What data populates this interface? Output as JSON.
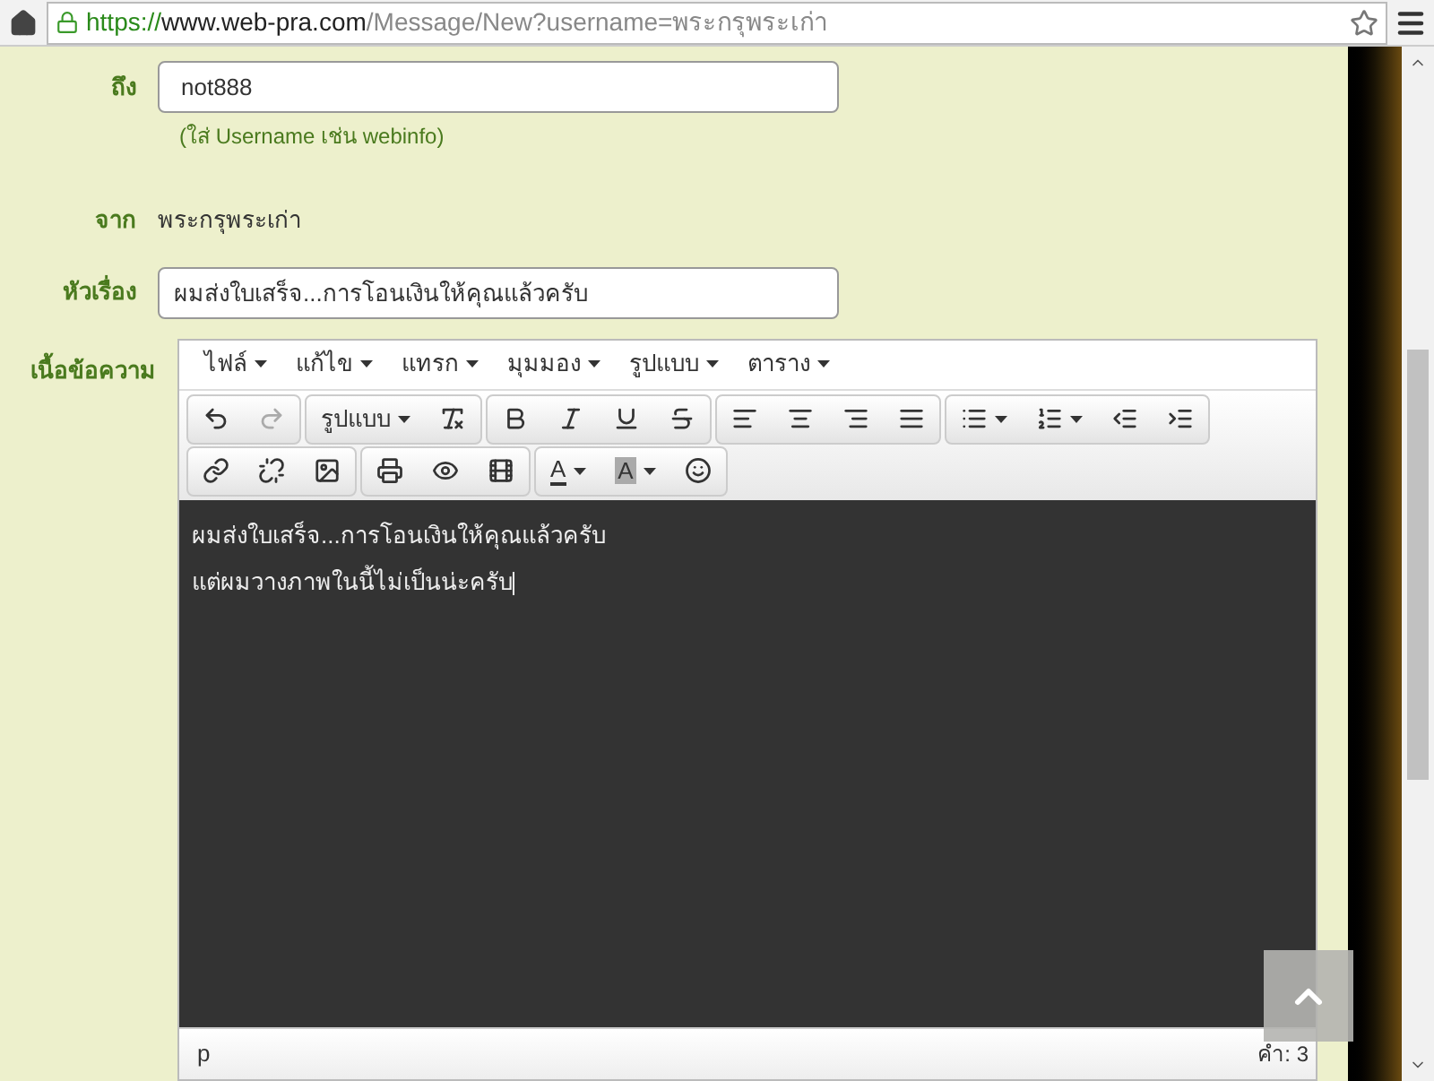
{
  "address_bar": {
    "scheme": "https://",
    "host": "www.web-pra.com",
    "path": "/Message/New?username=พระกรุพระเก่า"
  },
  "form": {
    "to": {
      "label": "ถึง",
      "value": "not888",
      "hint": "(ใส่ Username เช่น webinfo)"
    },
    "from": {
      "label": "จาก",
      "value": "พระกรุพระเก่า"
    },
    "subject": {
      "label": "หัวเรื่อง",
      "value": "ผมส่งใบเสร็จ...การโอนเงินให้คุณแล้วครับ"
    },
    "body_label": "เนื้อข้อความ"
  },
  "editor": {
    "menu": [
      "ไฟล์",
      "แก้ไข",
      "แทรก",
      "มุมมอง",
      "รูปแบบ",
      "ตาราง"
    ],
    "toolbar_rows": [
      [
        [
          {
            "kind": "icon",
            "disabled": false
          },
          {
            "kind": "icon",
            "disabled": true
          }
        ],
        [
          {
            "kind": "dropdown",
            "label": "รูปแบบ",
            "disabled": false
          },
          {
            "kind": "icon",
            "disabled": false
          }
        ],
        [
          {
            "kind": "icon",
            "disabled": false
          },
          {
            "kind": "icon",
            "disabled": false
          },
          {
            "kind": "icon",
            "disabled": false
          },
          {
            "kind": "icon",
            "disabled": false
          }
        ],
        [
          {
            "kind": "icon",
            "disabled": false
          },
          {
            "kind": "icon",
            "disabled": false
          },
          {
            "kind": "icon",
            "disabled": false
          },
          {
            "kind": "icon",
            "disabled": false
          }
        ],
        [
          {
            "kind": "icon-dropdown",
            "disabled": false
          },
          {
            "kind": "icon-dropdown",
            "disabled": false
          },
          {
            "kind": "icon",
            "disabled": false
          },
          {
            "kind": "icon",
            "disabled": false
          }
        ]
      ],
      [
        [
          {
            "kind": "icon",
            "disabled": false
          },
          {
            "kind": "icon",
            "disabled": false
          },
          {
            "kind": "icon",
            "disabled": false
          }
        ],
        [
          {
            "kind": "icon",
            "disabled": false
          },
          {
            "kind": "icon",
            "disabled": false
          },
          {
            "kind": "icon",
            "disabled": false
          }
        ],
        [
          {
            "kind": "color-dropdown",
            "label": "A",
            "disabled": false
          },
          {
            "kind": "highlight-dropdown",
            "label": "A",
            "disabled": false
          },
          {
            "kind": "icon",
            "disabled": false
          }
        ]
      ]
    ],
    "content": [
      "ผมส่งใบเสร็จ...การโอนเงินให้คุณแล้วครับ",
      "แต่ผมวางภาพในนี้ไม่เป็นน่ะครับ"
    ],
    "status_path": "p",
    "word_count": "คำ: 3"
  }
}
